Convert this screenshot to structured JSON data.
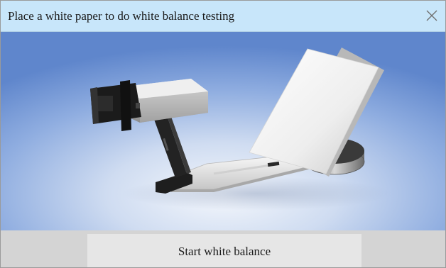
{
  "dialog": {
    "title": "Place a white paper to do white balance testing",
    "close_icon": "close-icon",
    "start_button_label": "Start white balance"
  },
  "colors": {
    "titlebar": "#c8e6fa",
    "background_top": "#5f86cc",
    "background_center": "#eef3fb",
    "footer": "#d4d4d4",
    "button": "#e6e6e6"
  }
}
